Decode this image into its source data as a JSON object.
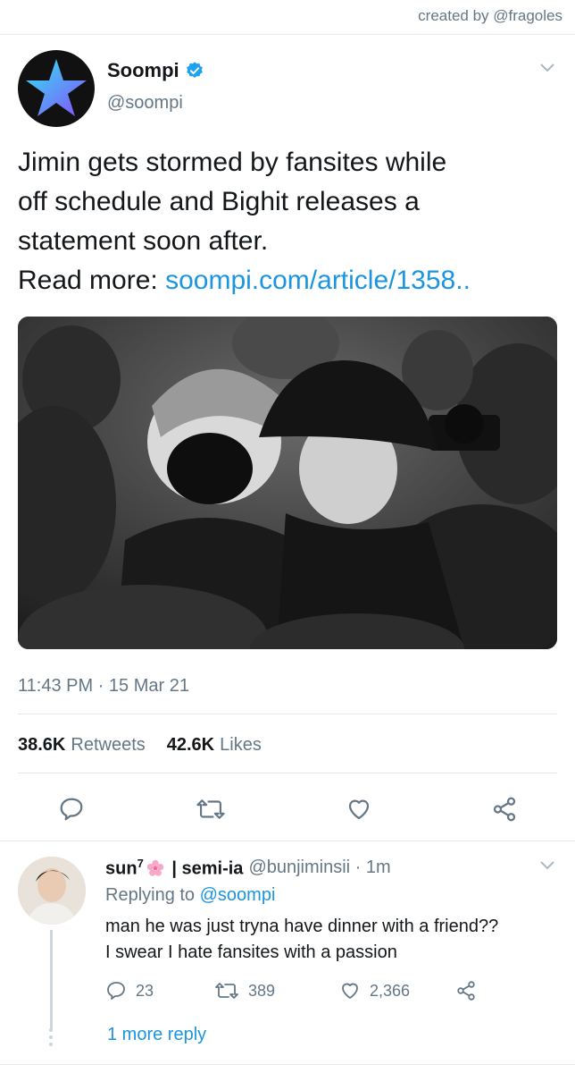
{
  "credit": "created by @fragoles",
  "tweet": {
    "author_name": "Soompi",
    "author_handle": "@soompi",
    "text_lines": [
      "Jimin gets stormed by fansites while",
      "off schedule and Bighit releases a",
      "statement soon after."
    ],
    "read_more_prefix": "Read more: ",
    "read_more_link": "soompi.com/article/1358..",
    "timestamp": "11:43 PM · 15 Mar 21",
    "retweets_count": "38.6K",
    "retweets_label": "Retweets",
    "likes_count": "42.6K",
    "likes_label": "Likes"
  },
  "reply": {
    "name": "sun",
    "name_sup": "7",
    "name_suffix": " | semi-ia",
    "handle_time": "@bunjiminsii · 1m",
    "replying_prefix": "Replying to ",
    "replying_handle": "@soompi",
    "text_line1": "man he was just tryna have dinner with a friend??",
    "text_line2": "I swear I hate fansites with a passion",
    "reply_count": "23",
    "retweet_count": "389",
    "like_count": "2,366",
    "more_replies": "1 more reply"
  },
  "colors": {
    "accent": "#1b95e0",
    "muted": "#657786",
    "divider": "#e1e8ed"
  },
  "icons": [
    "verified-badge-icon",
    "chevron-down-icon",
    "reply-icon",
    "retweet-icon",
    "like-icon",
    "share-icon",
    "cherry-blossom-icon"
  ]
}
